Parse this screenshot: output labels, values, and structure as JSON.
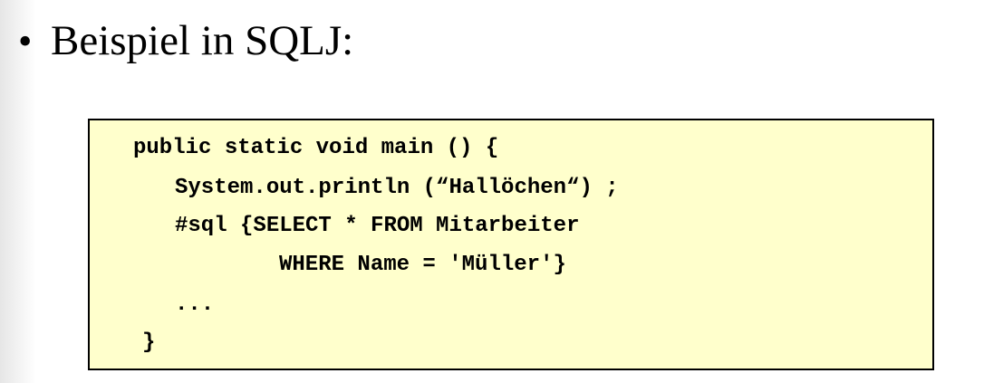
{
  "slide": {
    "bullet": "•",
    "heading": "Beispiel in SQLJ:"
  },
  "code": {
    "lines": [
      "public static void main () {",
      "System.out.println (“Hallöchen“) ;",
      "#sql {SELECT * FROM Mitarbeiter",
      "WHERE Name = 'Müller'}",
      "...",
      "}"
    ]
  },
  "colors": {
    "code_background": "#ffffcc",
    "code_border": "#000000",
    "text": "#000000"
  }
}
